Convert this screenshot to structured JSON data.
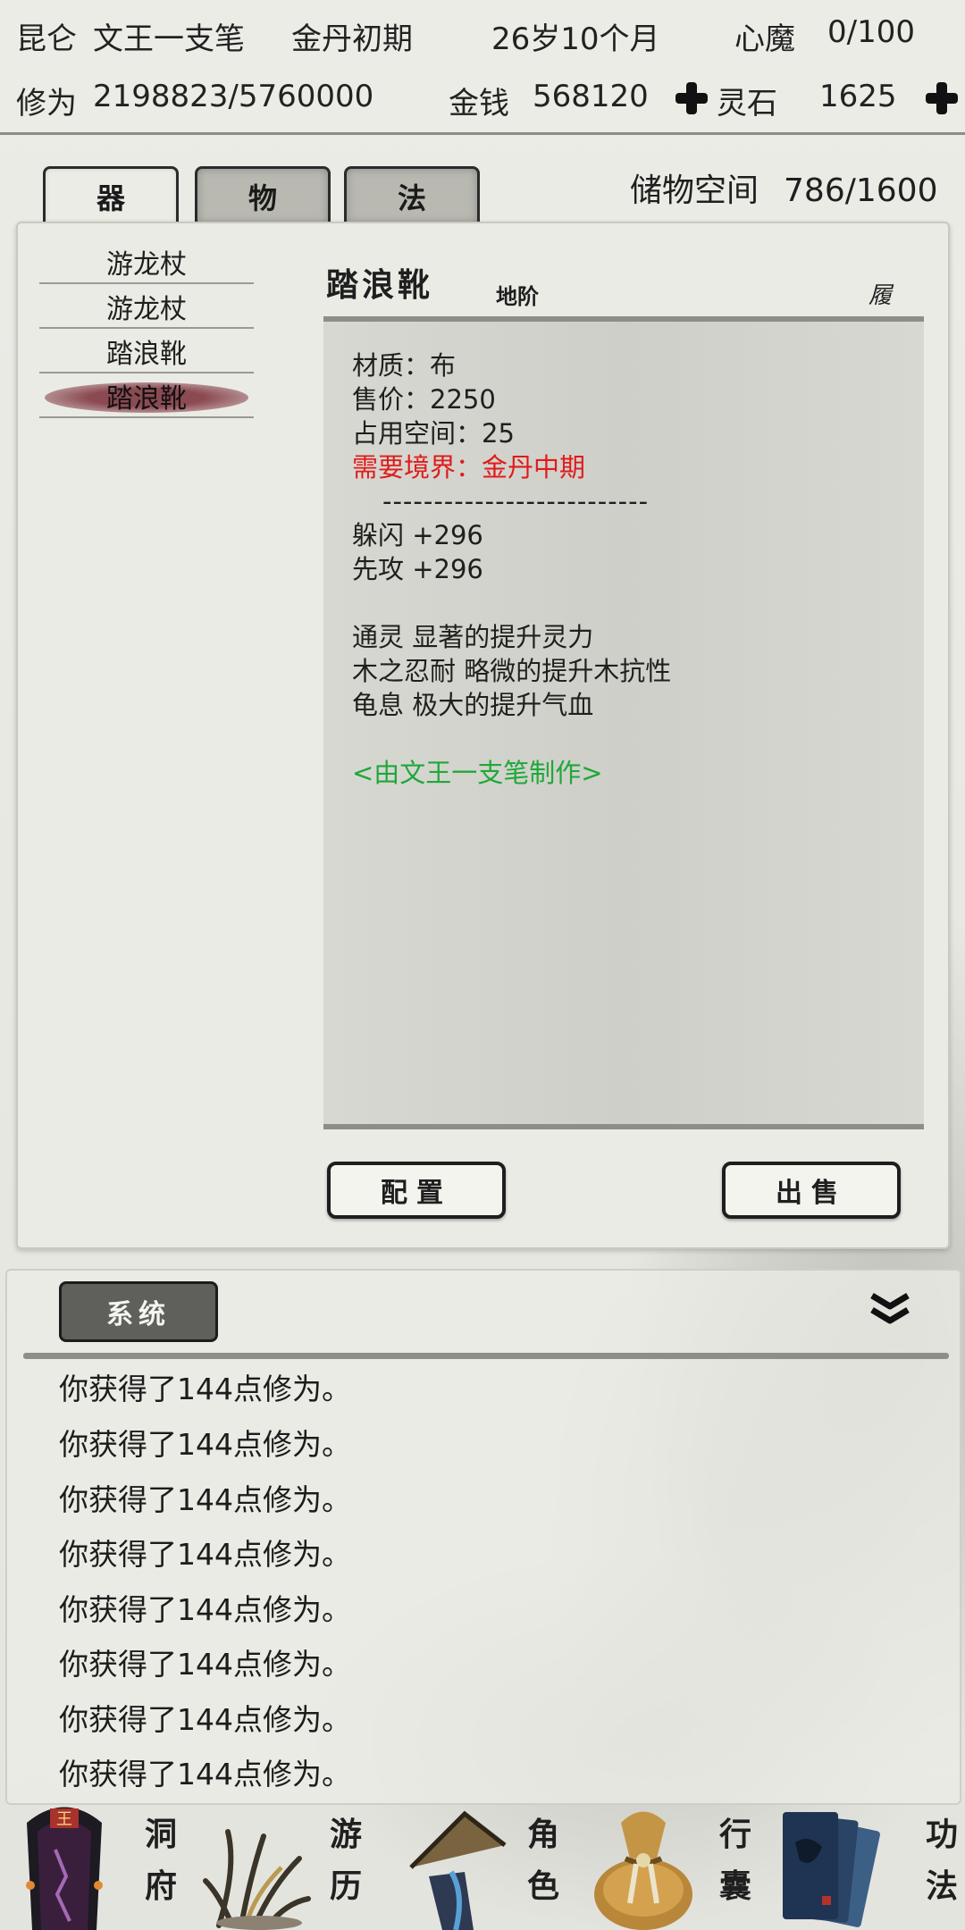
{
  "header": {
    "sect": "昆仑",
    "name": "文王一支笔",
    "realm": "金丹初期",
    "age": "26岁10个月",
    "demon_label": "心魔",
    "demon_value": "0/100",
    "cultivation_label": "修为",
    "cultivation_value": "2198823/5760000",
    "money_label": "金钱",
    "money_value": "568120",
    "stone_label": "灵石",
    "stone_value": "1625"
  },
  "tabs": [
    "器",
    "物",
    "法"
  ],
  "storage": {
    "label": "储物空间",
    "value": "786/1600"
  },
  "items": [
    "游龙杖",
    "游龙杖",
    "踏浪靴",
    "踏浪靴"
  ],
  "detail": {
    "name": "踏浪靴",
    "tier": "地阶",
    "slot": "履",
    "material": "材质：布",
    "price": "售价：2250",
    "space": "占用空间：25",
    "requirement": "需要境界：金丹中期",
    "separator": "--------------------------",
    "stats": [
      "躲闪 +296",
      "先攻 +296"
    ],
    "effects": [
      "通灵 显著的提升灵力",
      "木之忍耐 略微的提升木抗性",
      "龟息 极大的提升气血"
    ],
    "maker": "<由文王一支笔制作>"
  },
  "buttons": {
    "equip": "配置",
    "sell": "出售"
  },
  "log": {
    "tab": "系统",
    "messages": [
      "你获得了144点修为。",
      "你获得了144点修为。",
      "你获得了144点修为。",
      "你获得了144点修为。",
      "你获得了144点修为。",
      "你获得了144点修为。",
      "你获得了144点修为。",
      "你获得了144点修为。"
    ]
  },
  "nav": [
    {
      "l1": "洞",
      "l2": "府"
    },
    {
      "l1": "游",
      "l2": "历"
    },
    {
      "l1": "角",
      "l2": "色"
    },
    {
      "l1": "行",
      "l2": "囊"
    },
    {
      "l1": "功",
      "l2": "法"
    }
  ],
  "colors": {
    "requirement": "#e01b1b",
    "maker": "#1ea83a",
    "selected": "#8b4a52"
  }
}
